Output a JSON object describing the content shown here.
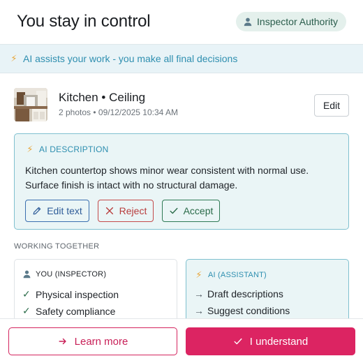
{
  "header": {
    "title": "You stay in control",
    "badge_label": "Inspector Authority"
  },
  "banner": {
    "text": "AI assists your work - you make all final decisions"
  },
  "photo": {
    "room": "Kitchen • Ceiling",
    "meta": "2 photos • 09/12/2025 10:34 AM",
    "edit_label": "Edit"
  },
  "ai_card": {
    "heading": "AI DESCRIPTION",
    "description": "Kitchen countertop shows minor wear consistent with normal use. Surface finish is intact with no structural damage.",
    "edit_text_label": "Edit text",
    "reject_label": "Reject",
    "accept_label": "Accept"
  },
  "working_together": {
    "label": "WORKING TOGETHER",
    "you": {
      "heading": "YOU (INSPECTOR)",
      "items": [
        "Physical inspection",
        "Safety compliance"
      ]
    },
    "ai": {
      "heading": "AI (ASSISTANT)",
      "items": [
        "Draft descriptions",
        "Suggest conditions"
      ]
    }
  },
  "footer": {
    "learn_more_label": "Learn more",
    "understand_label": "I understand"
  },
  "colors": {
    "accent_pink": "#dc2462",
    "ai_teal": "#2f8fb0",
    "success_green": "#2a6b49",
    "reject_red": "#b83d3d",
    "edit_blue": "#2f5d99"
  },
  "icons": {
    "badge": "user-icon",
    "banner": "lightning-icon",
    "edit_text": "pencil-icon",
    "reject": "x-icon",
    "accept": "check-icon",
    "learn_more": "arrow-right-icon",
    "understand": "check-icon"
  }
}
